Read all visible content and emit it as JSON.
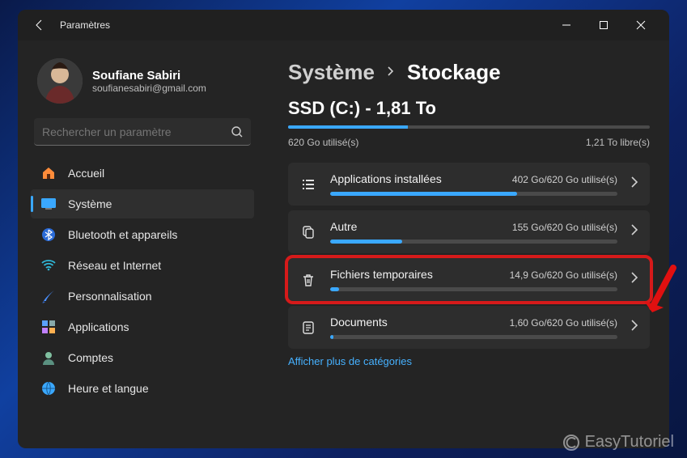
{
  "window": {
    "title": "Paramètres"
  },
  "profile": {
    "name": "Soufiane Sabiri",
    "email": "soufianesabiri@gmail.com"
  },
  "search": {
    "placeholder": "Rechercher un paramètre"
  },
  "nav": {
    "items": [
      {
        "label": "Accueil",
        "icon": "home-icon"
      },
      {
        "label": "Système",
        "icon": "system-icon",
        "active": true
      },
      {
        "label": "Bluetooth et appareils",
        "icon": "bluetooth-icon"
      },
      {
        "label": "Réseau et Internet",
        "icon": "wifi-icon"
      },
      {
        "label": "Personnalisation",
        "icon": "brush-icon"
      },
      {
        "label": "Applications",
        "icon": "apps-icon"
      },
      {
        "label": "Comptes",
        "icon": "user-icon"
      },
      {
        "label": "Heure et langue",
        "icon": "globe-icon"
      }
    ]
  },
  "breadcrumb": {
    "parent": "Système",
    "current": "Stockage"
  },
  "drive": {
    "title": "SSD (C:) - 1,81 To",
    "used_label": "620 Go utilisé(s)",
    "free_label": "1,21 To libre(s)",
    "fill_pct": 33
  },
  "categories": [
    {
      "icon": "list-icon",
      "name": "Applications installées",
      "meta": "402 Go/620 Go utilisé(s)",
      "fill_pct": 65
    },
    {
      "icon": "copy-icon",
      "name": "Autre",
      "meta": "155 Go/620 Go utilisé(s)",
      "fill_pct": 25
    },
    {
      "icon": "trash-icon",
      "name": "Fichiers temporaires",
      "meta": "14,9 Go/620 Go utilisé(s)",
      "fill_pct": 3,
      "highlight": true
    },
    {
      "icon": "doc-icon",
      "name": "Documents",
      "meta": "1,60 Go/620 Go utilisé(s)",
      "fill_pct": 1
    }
  ],
  "more_link": "Afficher plus de catégories",
  "watermark": "EasyTutoriel"
}
